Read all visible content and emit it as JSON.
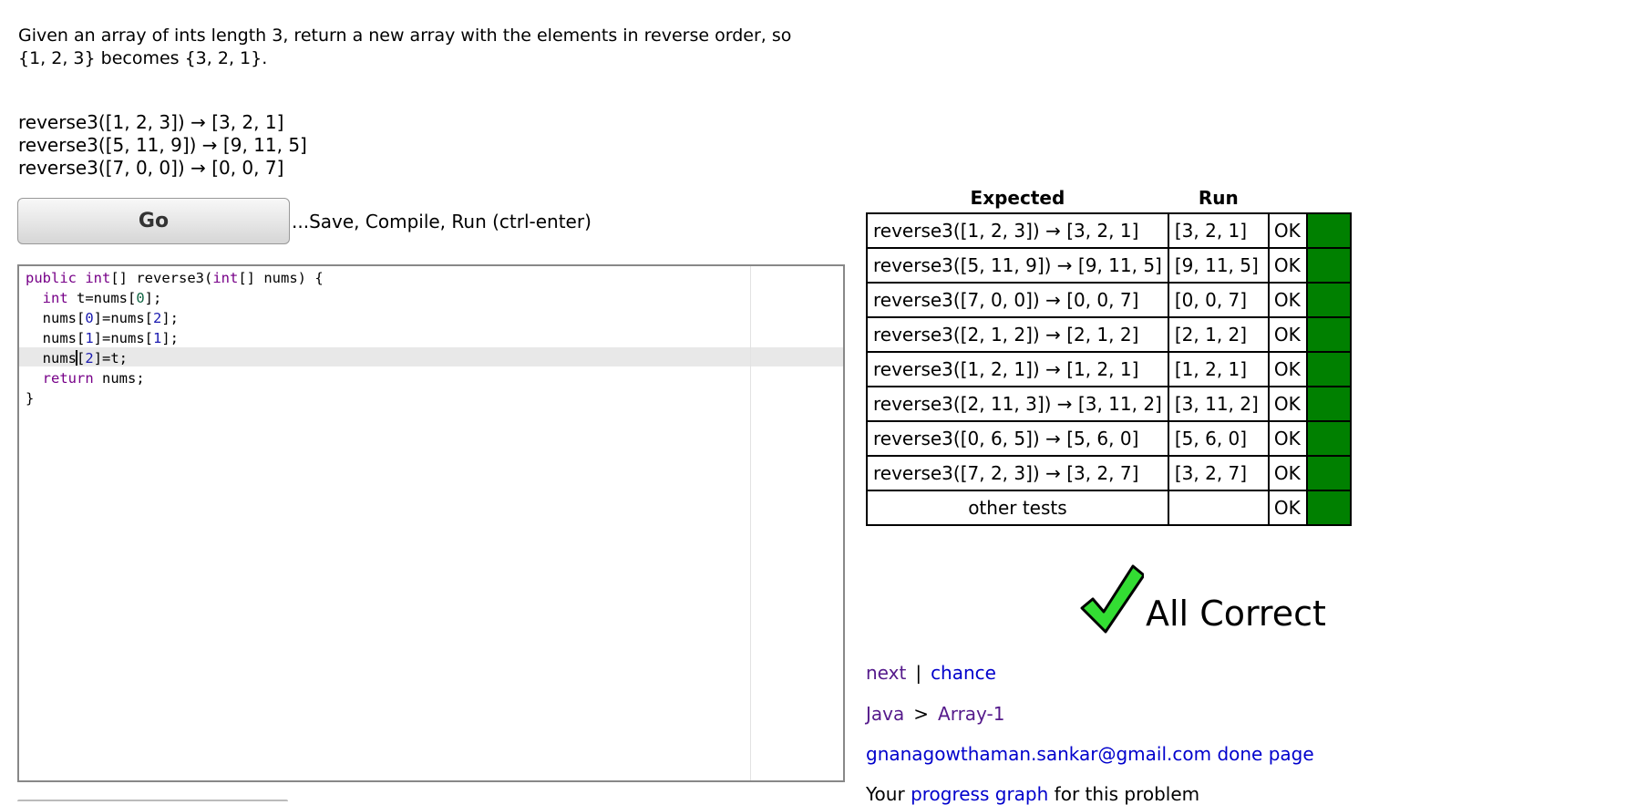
{
  "problem": {
    "description_line1": "Given an array of ints length 3, return a new array with the elements in reverse order, so",
    "description_line2": "{1, 2, 3} becomes {3, 2, 1}.",
    "examples": [
      "reverse3([1, 2, 3]) → [3, 2, 1]",
      "reverse3([5, 11, 9]) → [9, 11, 5]",
      "reverse3([7, 0, 0]) → [0, 0, 7]"
    ]
  },
  "toolbar": {
    "go_label": "Go",
    "go_hint": "...Save, Compile, Run (ctrl-enter)"
  },
  "editor": {
    "code_lines": [
      "public int[] reverse3(int[] nums) {",
      "  int t=nums[0];",
      "  nums[0]=nums[2];",
      "  nums[1]=nums[1];",
      "  nums[2]=t;",
      "  return nums;",
      "}"
    ]
  },
  "results": {
    "header_expected": "Expected",
    "header_run": "Run",
    "rows": [
      {
        "expected": "reverse3([1, 2, 3]) → [3, 2, 1]",
        "run": "[3, 2, 1]",
        "status": "OK"
      },
      {
        "expected": "reverse3([5, 11, 9]) → [9, 11, 5]",
        "run": "[9, 11, 5]",
        "status": "OK"
      },
      {
        "expected": "reverse3([7, 0, 0]) → [0, 0, 7]",
        "run": "[0, 0, 7]",
        "status": "OK"
      },
      {
        "expected": "reverse3([2, 1, 2]) → [2, 1, 2]",
        "run": "[2, 1, 2]",
        "status": "OK"
      },
      {
        "expected": "reverse3([1, 2, 1]) → [1, 2, 1]",
        "run": "[1, 2, 1]",
        "status": "OK"
      },
      {
        "expected": "reverse3([2, 11, 3]) → [3, 11, 2]",
        "run": "[3, 11, 2]",
        "status": "OK"
      },
      {
        "expected": "reverse3([0, 6, 5]) → [5, 6, 0]",
        "run": "[5, 6, 0]",
        "status": "OK"
      },
      {
        "expected": "reverse3([7, 2, 3]) → [3, 2, 7]",
        "run": "[3, 2, 7]",
        "status": "OK"
      }
    ],
    "other_tests_label": "other tests",
    "other_tests_run": "",
    "other_tests_status": "OK",
    "pass_color": "#008000"
  },
  "verdict": {
    "icon": "checkmark-icon",
    "text": "All Correct"
  },
  "nav": {
    "next": "next",
    "separator": "|",
    "chance": "chance",
    "crumb_java": "Java",
    "crumb_sep": ">",
    "crumb_section": "Array-1",
    "user_email": "gnanagowthaman.sankar@gmail.com",
    "done_page": "done page",
    "progress_prefix": "Your ",
    "progress_link": "progress graph",
    "progress_suffix": " for this problem"
  }
}
